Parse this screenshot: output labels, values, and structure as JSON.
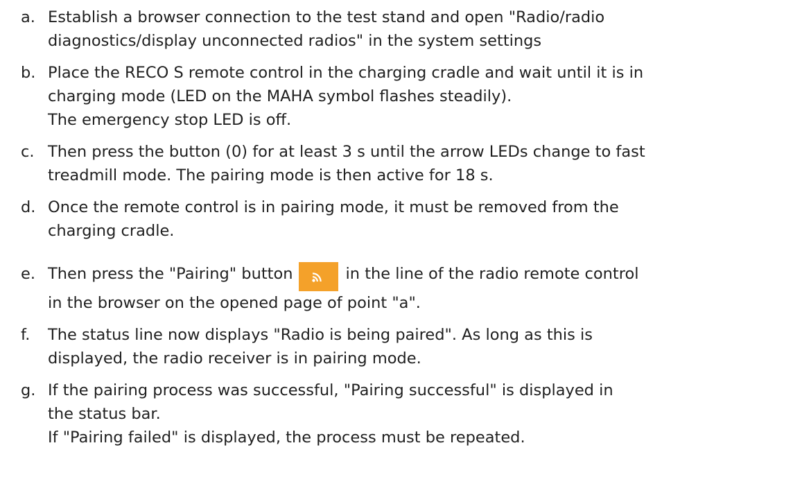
{
  "steps": [
    {
      "letter": "a.",
      "lines": [
        "Establish a browser connection to the test stand and open \"Radio/radio",
        "diagnostics/display unconnected radios\" in the system settings"
      ]
    },
    {
      "letter": "b.",
      "lines": [
        "Place the RECO S remote control in the charging cradle and wait until it is in",
        "charging mode (LED on the MAHA symbol flashes steadily).",
        "The emergency stop LED is off."
      ]
    },
    {
      "letter": "c.",
      "lines": [
        "Then press the button (0) for at least 3 s until the arrow LEDs change to fast",
        "treadmill mode. The pairing mode is then active for 18 s."
      ]
    },
    {
      "letter": "d.",
      "lines": [
        "Once the remote control is in pairing mode, it must be removed from the",
        "charging cradle."
      ]
    },
    {
      "letter": "e.",
      "line1_before": "Then press the \"Pairing\" button",
      "line1_after": "in the line of the radio remote control",
      "line2": "in the browser on the opened page of point \"a\".",
      "icon": "rss-feed-icon",
      "icon_color": "#f4a12a"
    },
    {
      "letter": "f.",
      "lines": [
        "The status line now displays \"Radio is being paired\". As long as this is",
        "displayed, the radio receiver is in pairing mode."
      ]
    },
    {
      "letter": "g.",
      "lines": [
        "If the pairing process was successful, \"Pairing successful\" is displayed in",
        "the status bar.",
        "If \"Pairing failed\" is displayed, the process must be repeated."
      ]
    }
  ]
}
